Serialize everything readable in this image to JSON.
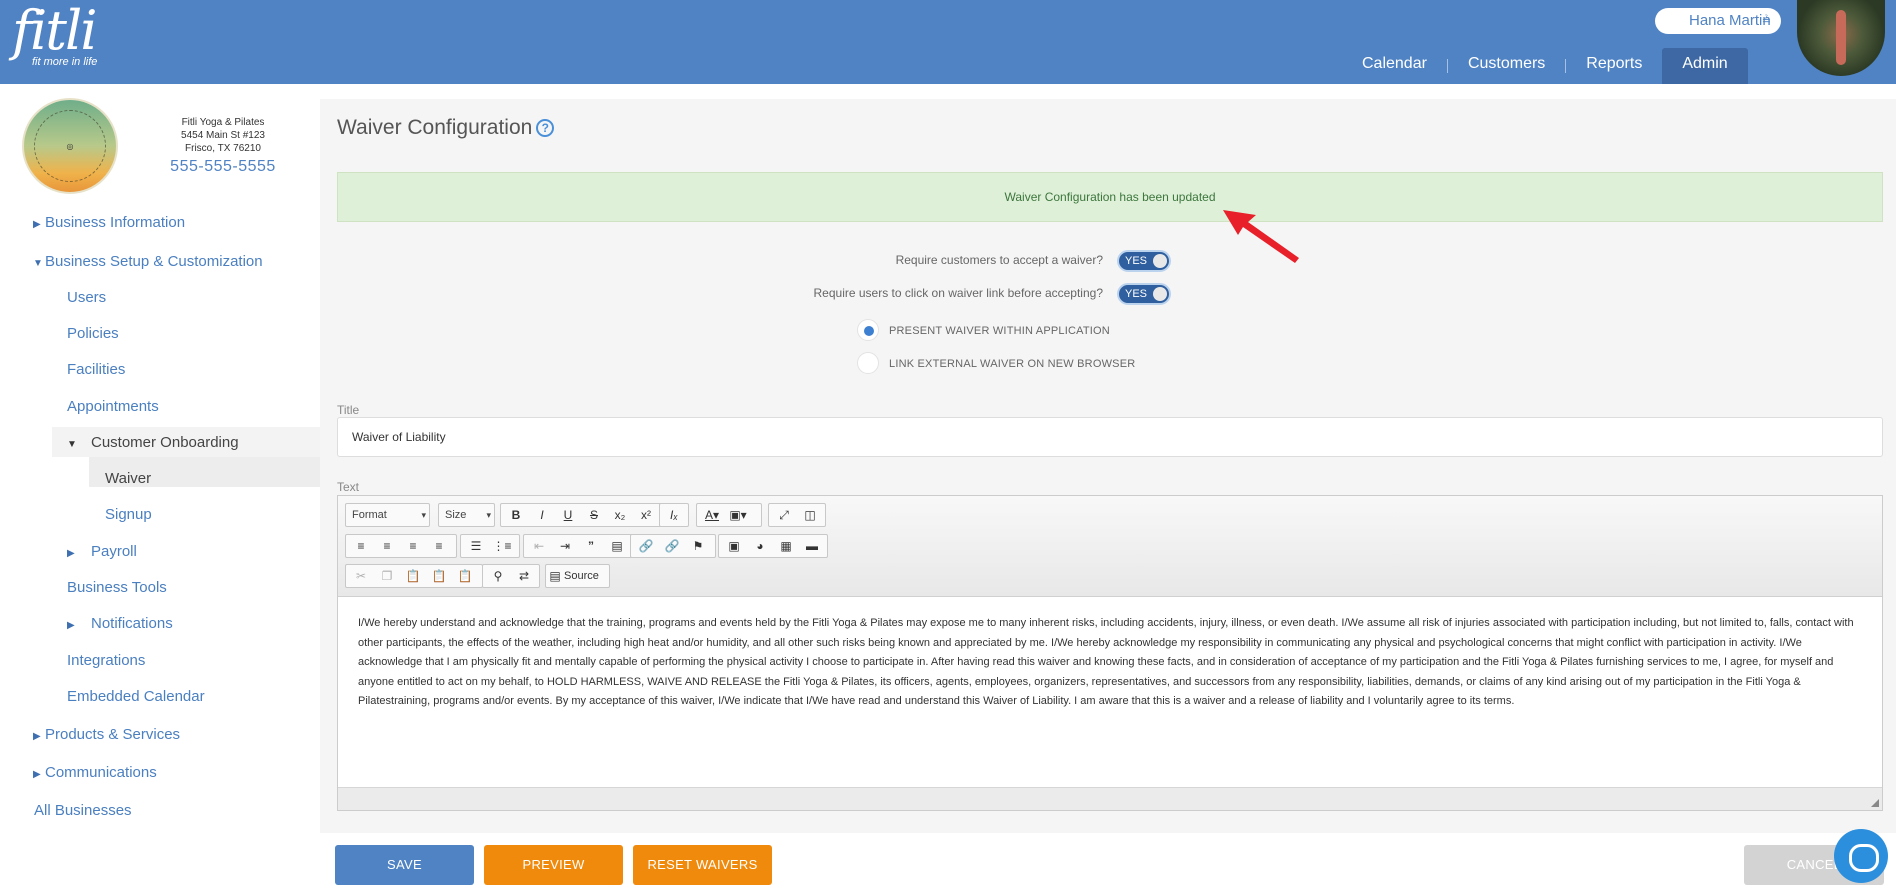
{
  "header": {
    "logo": "fitli",
    "logo_tagline": "fit more in life",
    "user_name": "Hana Martin",
    "nav": [
      "Calendar",
      "Customers",
      "Reports",
      "Admin"
    ],
    "active_nav": "Admin"
  },
  "business": {
    "name": "Fitli Yoga & Pilates",
    "address1": "5454 Main St #123",
    "address2": "Frisco, TX 76210",
    "phone": "555-555-5555",
    "logo_text": "FITLI YOGA & PILATES"
  },
  "sidebar": {
    "business_information": "Business Information",
    "business_setup": "Business Setup & Customization",
    "users": "Users",
    "policies": "Policies",
    "facilities": "Facilities",
    "appointments": "Appointments",
    "customer_onboarding": "Customer Onboarding",
    "waiver": "Waiver",
    "signup": "Signup",
    "payroll": "Payroll",
    "business_tools": "Business Tools",
    "notifications": "Notifications",
    "integrations": "Integrations",
    "embedded_calendar": "Embedded Calendar",
    "products_services": "Products & Services",
    "communications": "Communications",
    "all_businesses": "All Businesses"
  },
  "main": {
    "title": "Waiver Configuration",
    "help_icon": "?",
    "alert": "Waiver Configuration has been updated",
    "require_accept_label": "Require customers to accept a waiver?",
    "require_accept_value": "YES",
    "require_click_label": "Require users to click on waiver link before accepting?",
    "require_click_value": "YES",
    "radio_present": "PRESENT WAIVER WITHIN APPLICATION",
    "radio_link": "LINK EXTERNAL WAIVER ON NEW BROWSER",
    "radio_selected": "PRESENT WAIVER WITHIN APPLICATION",
    "title_label": "Title",
    "title_value": "Waiver of Liability",
    "text_label": "Text",
    "toolbar": {
      "format": "Format",
      "size": "Size",
      "source": "Source"
    },
    "waiver_text": "I/We hereby understand and acknowledge that the training, programs and events held by the Fitli Yoga & Pilates may expose me to many inherent risks, including accidents, injury, illness, or even death. I/We assume all risk of injuries associated with participation including, but not limited to, falls, contact with other participants, the effects of the weather, including high heat and/or humidity, and all other such risks being known and appreciated by me. I/We hereby acknowledge my responsibility in communicating any physical and psychological concerns that might conflict with participation in activity. I/We acknowledge that I am physically fit and mentally capable of performing the physical activity I choose to participate in. After having read this waiver and knowing these facts, and in consideration of acceptance of my participation and the Fitli Yoga & Pilates furnishing services to me, I agree, for myself and anyone entitled to act on my behalf, to HOLD HARMLESS, WAIVE AND RELEASE the Fitli Yoga & Pilates, its officers, agents, employees, organizers, representatives, and successors from any responsibility, liabilities, demands, or claims of any kind arising out of my participation in the Fitli Yoga & Pilatestraining, programs and/or events. By my acceptance of this waiver, I/We indicate that I/We have read and understand this Waiver of Liability. I am aware that this is a waiver and a release of liability and I voluntarily agree to its terms."
  },
  "actions": {
    "save": "SAVE",
    "preview": "PREVIEW",
    "reset": "RESET WAIVERS",
    "cancel": "CANCEL"
  },
  "colors": {
    "header": "#5083c4",
    "accent_orange": "#f08a0c",
    "alert_bg": "#dff0d8",
    "arrow": "#e8202a"
  }
}
